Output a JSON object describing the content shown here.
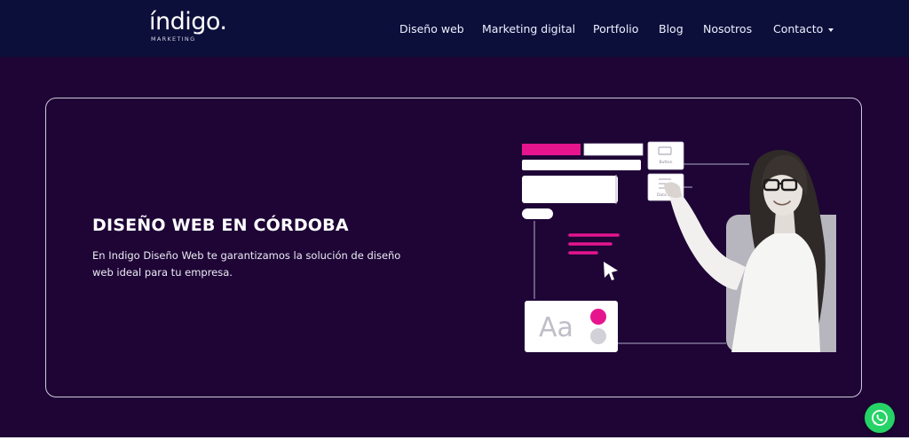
{
  "header": {
    "logo_text": "índigo.",
    "logo_subtitle": "MARKETING",
    "nav": [
      {
        "label": "Diseño web"
      },
      {
        "label": "Marketing digital"
      },
      {
        "label": "Portfolio"
      },
      {
        "label": "Blog"
      },
      {
        "label": "Nosotros"
      },
      {
        "label": "Contacto",
        "has_dropdown": true
      }
    ]
  },
  "hero": {
    "title": "DISEÑO WEB EN CÓRDOBA",
    "text": "En Indigo Diseño Web te garantizamos la solución de diseño web ideal para tu empresa.",
    "illustration": {
      "button_card_label": "Button",
      "list_card_label": "Data List",
      "typography_sample": "Aa"
    }
  },
  "floating": {
    "whatsapp_icon": "whatsapp-icon"
  },
  "colors": {
    "header_bg": "#0c0f3a",
    "page_bg": "#1e0536",
    "accent_pink": "#e6158e",
    "whatsapp_green": "#25d366"
  }
}
